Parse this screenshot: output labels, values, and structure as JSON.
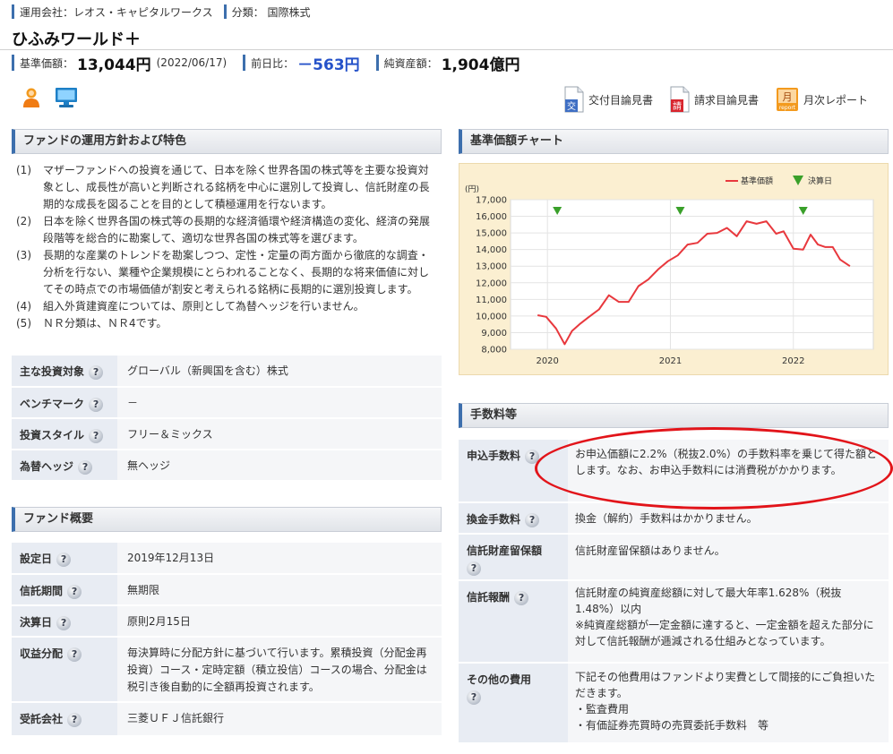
{
  "header": {
    "company_label": "運用会社：レオス・キャピタルワークス",
    "category_label": "分類： 国際株式",
    "fund_name": "ひふみワールド＋",
    "nav_label": "基準価額：",
    "nav_value": "13,044円",
    "nav_date": "(2022/06/17)",
    "change_label": "前日比：",
    "change_value": "－563円",
    "assets_label": "純資産額：",
    "assets_value": "1,904億円"
  },
  "icons": {
    "person": "person-icon",
    "pc": "computer-icon"
  },
  "doc_links": [
    {
      "label": "交付目論見書",
      "icon": "prospectus-icon",
      "glyph": "交"
    },
    {
      "label": "請求目論見書",
      "icon": "request-prospectus-icon",
      "glyph": "請"
    },
    {
      "label": "月次レポート",
      "icon": "monthly-report-icon",
      "glyph": "月"
    }
  ],
  "policy": {
    "title": "ファンドの運用方針および特色",
    "items": [
      {
        "num": "(1)",
        "text": "マザーファンドへの投資を通じて、日本を除く世界各国の株式等を主要な投資対象とし、成長性が高いと判断される銘柄を中心に選別して投資し、信託財産の長期的な成長を図ることを目的として積極運用を行ないます。"
      },
      {
        "num": "(2)",
        "text": "日本を除く世界各国の株式等の長期的な経済循環や経済構造の変化、経済の発展段階等を総合的に勘案して、適切な世界各国の株式等を選びます。"
      },
      {
        "num": "(3)",
        "text": "長期的な産業のトレンドを勘案しつつ、定性・定量の両方面から徹底的な調査・分析を行ない、業種や企業規模にとらわれることなく、長期的な将来価値に対してその時点での市場価値が割安と考えられる銘柄に長期的に選別投資します。"
      },
      {
        "num": "(4)",
        "text": "組入外貨建資産については、原則として為替ヘッジを行いません。"
      },
      {
        "num": "(5)",
        "text": "ＮＲ分類は、ＮＲ4です。"
      }
    ]
  },
  "attributes": [
    {
      "key": "主な投資対象",
      "value": "グローバル（新興国を含む）株式"
    },
    {
      "key": "ベンチマーク",
      "value": "－"
    },
    {
      "key": "投資スタイル",
      "value": "フリー＆ミックス"
    },
    {
      "key": "為替ヘッジ",
      "value": "無ヘッジ"
    }
  ],
  "overview": {
    "title": "ファンド概要",
    "rows": [
      {
        "key": "設定日",
        "value": "2019年12月13日"
      },
      {
        "key": "信託期間",
        "value": "無期限"
      },
      {
        "key": "決算日",
        "value": "原則2月15日"
      },
      {
        "key": "収益分配",
        "value": "毎決算時に分配方針に基づいて行います。累積投資（分配金再投資）コース・定時定額（積立投信）コースの場合、分配金は税引き後自動的に全額再投資されます。"
      },
      {
        "key": "受託会社",
        "value": "三菱ＵＦＪ信託銀行"
      }
    ]
  },
  "chart_section_title": "基準価額チャート",
  "chart_data": {
    "type": "line",
    "ylabel": "(円)",
    "ylim": [
      8000,
      17000
    ],
    "yticks": [
      "17,000",
      "16,000",
      "15,000",
      "14,000",
      "13,000",
      "12,000",
      "11,000",
      "10,000",
      "9,000",
      "8,000"
    ],
    "xticks": [
      "2020",
      "2021",
      "2022"
    ],
    "xlim": [
      2019.7,
      2022.65
    ],
    "legend": {
      "series_label": "基準価額",
      "marker_label": "決算日",
      "placement": "top-right"
    },
    "colors": {
      "line": "#e8383d",
      "marker": "#3aa02a",
      "background": "#fbefd1"
    },
    "series": [
      {
        "name": "基準価額",
        "x": [
          2019.92,
          2019.99,
          2020.07,
          2020.14,
          2020.2,
          2020.26,
          2020.33,
          2020.42,
          2020.5,
          2020.58,
          2020.66,
          2020.74,
          2020.82,
          2020.9,
          2020.98,
          2021.06,
          2021.14,
          2021.22,
          2021.3,
          2021.38,
          2021.46,
          2021.54,
          2021.62,
          2021.7,
          2021.78,
          2021.86,
          2021.92,
          2022.0,
          2022.08,
          2022.14,
          2022.2,
          2022.26,
          2022.32,
          2022.38,
          2022.46
        ],
        "y": [
          10050,
          9950,
          9250,
          8300,
          9100,
          9500,
          9900,
          10400,
          11250,
          10850,
          10850,
          11800,
          12200,
          12800,
          13300,
          13650,
          14300,
          14400,
          14950,
          15000,
          15300,
          14800,
          15700,
          15550,
          15700,
          14950,
          15100,
          14050,
          14000,
          14900,
          14300,
          14150,
          14150,
          13400,
          13000
        ]
      }
    ],
    "settlement_markers_x": [
      2020.08,
      2021.08,
      2022.08
    ]
  },
  "fees": {
    "title": "手数料等",
    "rows": [
      {
        "key": "申込手数料",
        "value": "お申込価額に2.2%（税抜2.0%）の手数料率を乗じて得た額とします。なお、お申込手数料には消費税がかかります。"
      },
      {
        "key": "換金手数料",
        "value": "換金（解約）手数料はかかりません。"
      },
      {
        "key": "信託財産留保額",
        "value": "信託財産留保額はありません。"
      },
      {
        "key": "信託報酬",
        "value": "信託財産の純資産総額に対して最大年率1.628%（税抜1.48%）以内\n※純資産総額が一定金額に達すると、一定金額を超えた部分に対して信託報酬が逓減される仕組みとなっています。"
      },
      {
        "key": "その他の費用",
        "value": "下記その他費用はファンドより実費として間接的にご負担いただきます。\n・監査費用\n・有価証券売買時の売買委託手数料　等"
      }
    ]
  },
  "help_glyph": "?"
}
